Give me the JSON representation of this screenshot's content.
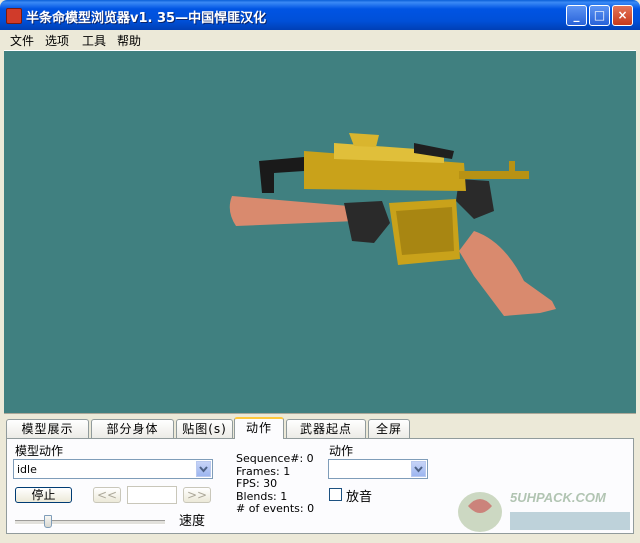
{
  "window": {
    "title": "半条命模型浏览器v1. 35—中国悍匪汉化",
    "minimize_glyph": "_",
    "maximize_glyph": "□",
    "close_glyph": "×"
  },
  "menu": [
    "文件",
    "选项",
    "工具",
    "帮助"
  ],
  "tabs": [
    {
      "label": "模型展示",
      "active": false
    },
    {
      "label": "部分身体",
      "active": false
    },
    {
      "label": "贴图(s)",
      "active": false
    },
    {
      "label": "动作",
      "active": true
    },
    {
      "label": "武器起点",
      "active": false
    },
    {
      "label": "全屏",
      "active": false
    }
  ],
  "panel": {
    "sequence_label": "模型动作",
    "sequence_value": "idle",
    "stop_button": "停止",
    "prev_button": "<<",
    "next_button": ">>",
    "frame_value": "",
    "speed_label": "速度",
    "speed_level": 0.2,
    "stats": {
      "sequence": "Sequence#: 0",
      "frames": "Frames: 1",
      "fps": "FPS: 30",
      "blends": "Blends: 1",
      "events": "# of events: 0"
    },
    "action_label": "动作",
    "action_value": "",
    "sound_checkbox_label": "放音",
    "sound_checked": false
  },
  "watermark": {
    "text": "5UHPACK.COM"
  },
  "colors": {
    "viewport_bg": "#408080",
    "title_bar": "#0054e3",
    "active_tab_accent": "#ffc83c"
  }
}
